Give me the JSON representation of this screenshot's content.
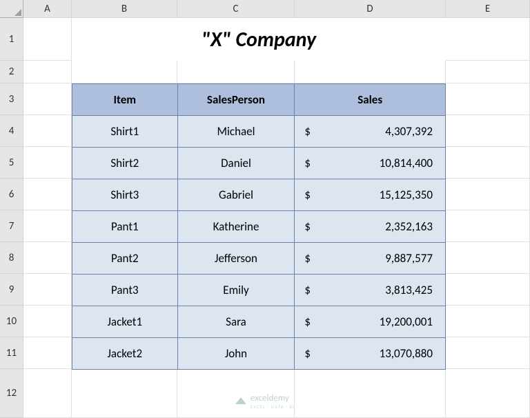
{
  "columns": [
    "",
    "A",
    "B",
    "C",
    "D",
    "E"
  ],
  "rows": [
    "1",
    "2",
    "3",
    "4",
    "5",
    "6",
    "7",
    "8",
    "9",
    "10",
    "11",
    "12"
  ],
  "title": "\"X\" Company",
  "headers": {
    "item": "Item",
    "salesperson": "SalesPerson",
    "sales": "Sales"
  },
  "currency": "$",
  "data": [
    {
      "item": "Shirt1",
      "salesperson": "Michael",
      "sales": "4,307,392"
    },
    {
      "item": "Shirt2",
      "salesperson": "Daniel",
      "sales": "10,814,400"
    },
    {
      "item": "Shirt3",
      "salesperson": "Gabriel",
      "sales": "15,125,350"
    },
    {
      "item": "Pant1",
      "salesperson": "Katherine",
      "sales": "2,352,163"
    },
    {
      "item": "Pant2",
      "salesperson": "Jefferson",
      "sales": "9,887,577"
    },
    {
      "item": "Pant3",
      "salesperson": "Emily",
      "sales": "3,813,425"
    },
    {
      "item": "Jacket1",
      "salesperson": "Sara",
      "sales": "19,200,001"
    },
    {
      "item": "Jacket2",
      "salesperson": "John",
      "sales": "13,070,880"
    }
  ],
  "watermark": {
    "name": "exceldemy",
    "sub": "EXCEL · DATA · BI"
  }
}
